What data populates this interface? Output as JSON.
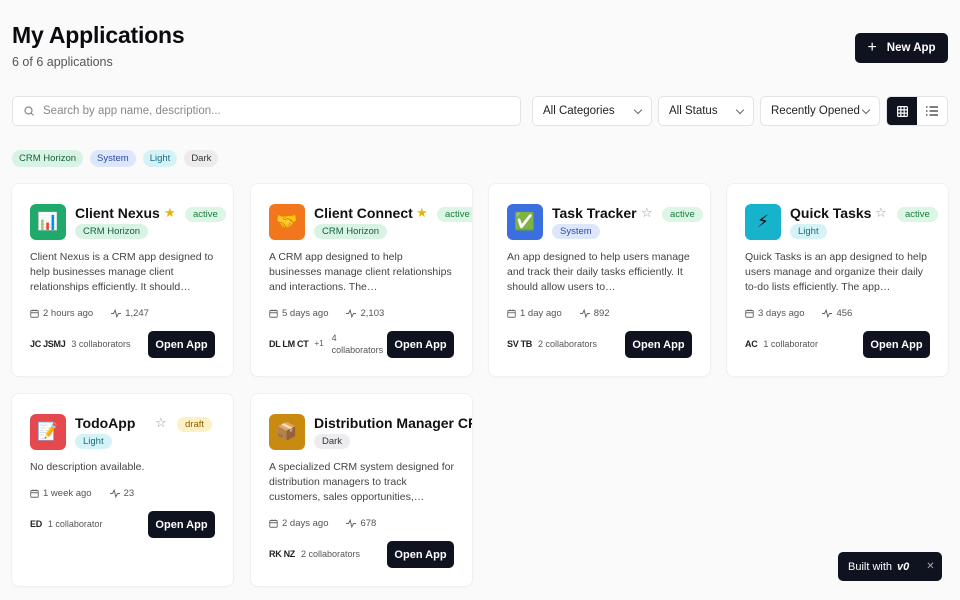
{
  "header": {
    "title": "My Applications",
    "subtitle": "6 of 6 applications"
  },
  "new_app_label": "New App",
  "search": {
    "placeholder": "Search by app name, description..."
  },
  "filters": {
    "category": "All Categories",
    "status": "All Status",
    "sort": "Recently Opened"
  },
  "tags": [
    "CRM Horizon",
    "System",
    "Light",
    "Dark"
  ],
  "open_label": "Open App",
  "built_with": {
    "label": "Built with",
    "logo": "v0"
  },
  "apps": [
    {
      "name": "Client Nexus",
      "category": "CRM Horizon",
      "status": "active",
      "starred": true,
      "icon": "chart-icon",
      "icon_glyph": "📊",
      "icon_bg": "#1faa6b",
      "description": "Client Nexus is a CRM app designed to help businesses manage client relationships efficiently. It should…",
      "opened": "2 hours ago",
      "views": "1,247",
      "initials": "JC JSMJ",
      "collaborators": "3 collaborators"
    },
    {
      "name": "Client Connect",
      "category": "CRM Horizon",
      "status": "active",
      "starred": true,
      "icon": "handshake-icon",
      "icon_glyph": "🤝",
      "icon_bg": "#f2761c",
      "description": "A CRM app designed to help businesses manage client relationships and interactions. The…",
      "opened": "5 days ago",
      "views": "2,103",
      "initials": "DL LM CT",
      "extra": "+1",
      "collaborators": "4 collaborators"
    },
    {
      "name": "Task Tracker",
      "category": "System",
      "status": "active",
      "starred": false,
      "icon": "checkmark-icon",
      "icon_glyph": "✅",
      "icon_bg": "#3b6fe0",
      "description": "An app designed to help users manage and track their daily tasks efficiently. It should allow users to…",
      "opened": "1 day ago",
      "views": "892",
      "initials": "SV TB",
      "collaborators": "2 collaborators"
    },
    {
      "name": "Quick Tasks",
      "category": "Light",
      "status": "active",
      "starred": false,
      "icon": "lightning-icon",
      "icon_glyph": "⚡",
      "icon_bg": "#17b3cc",
      "description": "Quick Tasks is an app designed to help users manage and organize their daily to-do lists efficiently. The app…",
      "opened": "3 days ago",
      "views": "456",
      "initials": "AC",
      "collaborators": "1 collaborator"
    },
    {
      "name": "TodoApp",
      "category": "Light",
      "status": "draft",
      "starred": false,
      "icon": "memo-icon",
      "icon_glyph": "📝",
      "icon_bg": "#e5484d",
      "description": "No description available.",
      "opened": "1 week ago",
      "views": "23",
      "initials": "ED",
      "collaborators": "1 collaborator"
    },
    {
      "name": "Distribution Manager CRM",
      "category": "Dark",
      "status": "",
      "starred": false,
      "icon": "package-icon",
      "icon_glyph": "📦",
      "icon_bg": "#c98a10",
      "description": "A specialized CRM system designed for distribution managers to track customers, sales opportunities,…",
      "opened": "2 days ago",
      "views": "678",
      "initials": "RK NZ",
      "collaborators": "2 collaborators"
    }
  ]
}
